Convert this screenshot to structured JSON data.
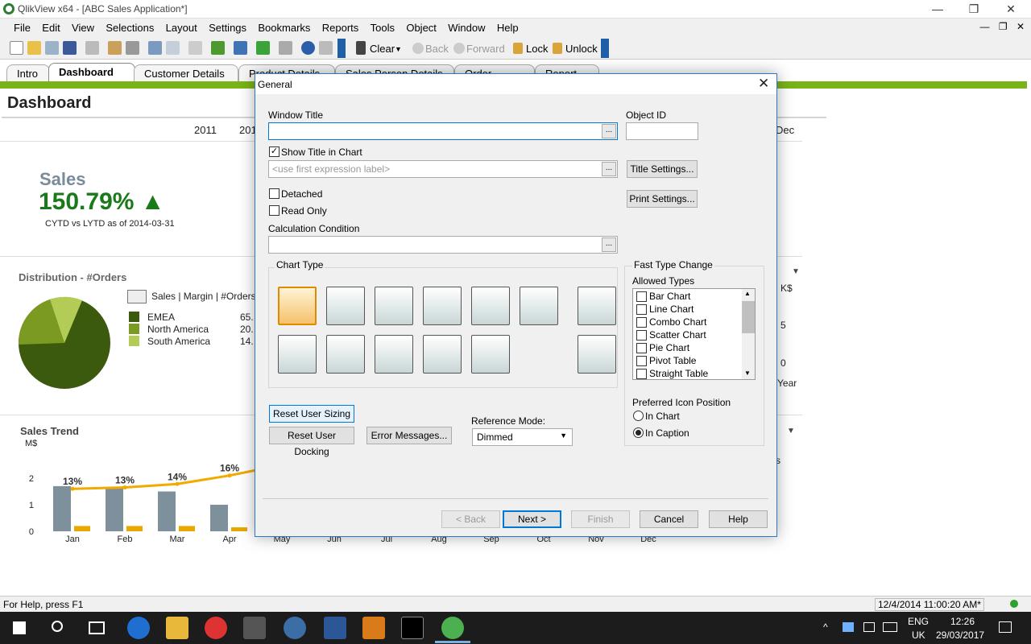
{
  "window": {
    "title": "QlikView x64 - [ABC Sales Application*]"
  },
  "menu": [
    "File",
    "Edit",
    "View",
    "Selections",
    "Layout",
    "Settings",
    "Bookmarks",
    "Reports",
    "Tools",
    "Object",
    "Window",
    "Help"
  ],
  "toolbar": {
    "clear": "Clear",
    "back": "Back",
    "forward": "Forward",
    "lock": "Lock",
    "unlock": "Unlock"
  },
  "tabs": [
    "Intro",
    "Dashboard",
    "Customer Details",
    "Product Details",
    "Sales Person Details",
    "Order Details",
    "Report"
  ],
  "sheet": {
    "title": "Dashboard",
    "years": [
      "2011",
      "201"
    ],
    "month_right": "Dec",
    "kpi": {
      "label": "Sales",
      "value": "150.79%",
      "arrow": "▲",
      "sub": "CYTD vs LYTD as of 2014-03-31"
    },
    "distribution": {
      "title": "Distribution - #Orders",
      "selector": "Sales | Margin | #Orders",
      "legend": [
        {
          "name": "EMEA",
          "value": "65.",
          "color": "#3c5a0e"
        },
        {
          "name": "North America",
          "value": "20.",
          "color": "#7a9a22"
        },
        {
          "name": "South America",
          "value": "14.",
          "color": "#b3cc55"
        }
      ]
    },
    "right_fragments": [
      "K$",
      "5",
      "0",
      "Year",
      "s"
    ],
    "trend": {
      "title": "Sales Trend",
      "unit": "M$"
    }
  },
  "chart_data": {
    "type": "bar",
    "title": "Sales Trend",
    "ylabel": "M$",
    "categories": [
      "Jan",
      "Feb",
      "Mar",
      "Apr",
      "May",
      "Jun",
      "Jul",
      "Aug",
      "Sep",
      "Oct",
      "Nov",
      "Dec"
    ],
    "y_ticks": [
      "2",
      "1",
      "0"
    ],
    "ylim": [
      0,
      2.5
    ],
    "series": [
      {
        "values": [
          1.7,
          1.65,
          1.5,
          1.0
        ],
        "color": "#7e909c"
      },
      {
        "values": [
          0.2,
          0.2,
          0.2,
          0.15
        ],
        "color": "#e8a800"
      }
    ],
    "line_labels": [
      "13%",
      "13%",
      "14%",
      "16%"
    ],
    "line_values": [
      1.6,
      1.65,
      1.78,
      2.1
    ],
    "line_color": "#f2a900"
  },
  "dialog": {
    "title": "General",
    "window_title_label": "Window Title",
    "window_title_value": "",
    "object_id_label": "Object ID",
    "object_id_value": "",
    "show_title_label": "Show Title in Chart",
    "title_placeholder": "<use first expression label>",
    "title_settings": "Title Settings...",
    "print_settings": "Print Settings...",
    "detached": "Detached",
    "read_only": "Read Only",
    "calc_condition_label": "Calculation Condition",
    "chart_type_label": "Chart Type",
    "fast_type_label": "Fast Type Change",
    "allowed_types_label": "Allowed Types",
    "allowed_types": [
      "Bar Chart",
      "Line Chart",
      "Combo Chart",
      "Scatter Chart",
      "Pie Chart",
      "Pivot Table",
      "Straight Table"
    ],
    "preferred_icon_label": "Preferred Icon Position",
    "in_chart": "In Chart",
    "in_caption": "In Caption",
    "reset_sizing": "Reset User Sizing",
    "reset_docking": "Reset User Docking",
    "error_messages": "Error Messages...",
    "reference_mode_label": "Reference Mode:",
    "reference_mode_value": "Dimmed",
    "back": "< Back",
    "next": "Next >",
    "finish": "Finish",
    "cancel": "Cancel",
    "help": "Help",
    "ellipsis": "..."
  },
  "status": {
    "help": "For Help, press F1",
    "timestamp": "12/4/2014 11:00:20 AM*"
  },
  "taskbar": {
    "lang": "ENG",
    "region": "UK",
    "time": "12:26",
    "date": "29/03/2017"
  }
}
